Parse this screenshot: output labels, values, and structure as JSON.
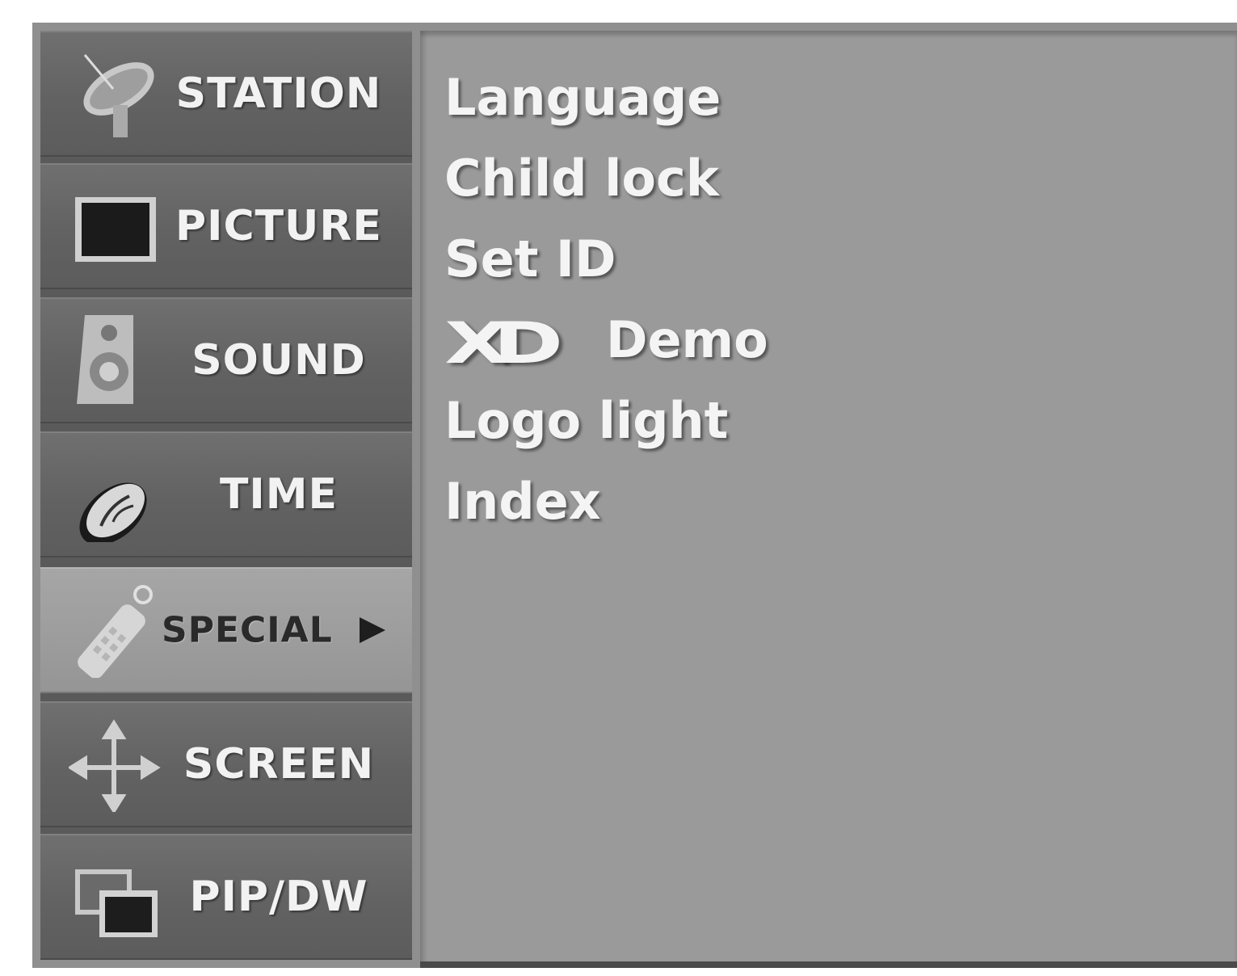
{
  "sidebar": {
    "items": [
      {
        "label": "STATION",
        "icon": "satellite-dish-icon",
        "active": false
      },
      {
        "label": "PICTURE",
        "icon": "picture-screen-icon",
        "active": false
      },
      {
        "label": "SOUND",
        "icon": "speaker-icon",
        "active": false
      },
      {
        "label": "TIME",
        "icon": "clock-icon",
        "active": false
      },
      {
        "label": "SPECIAL",
        "icon": "remote-control-icon",
        "active": true
      },
      {
        "label": "SCREEN",
        "icon": "move-arrows-icon",
        "active": false
      },
      {
        "label": "PIP/DW",
        "icon": "pip-windows-icon",
        "active": false
      }
    ]
  },
  "submenu": {
    "items": [
      {
        "label": "Language"
      },
      {
        "label": "Child lock"
      },
      {
        "label": "Set ID"
      },
      {
        "label": "Demo",
        "logo": "XD"
      },
      {
        "label": "Logo light"
      },
      {
        "label": "Index"
      }
    ]
  },
  "colors": {
    "panel": "#8f8f8f",
    "sidebar_item": "#626262",
    "sidebar_active": "#9c9c9c",
    "content_bg": "#9a9a9a",
    "text": "#f4f4f4"
  }
}
